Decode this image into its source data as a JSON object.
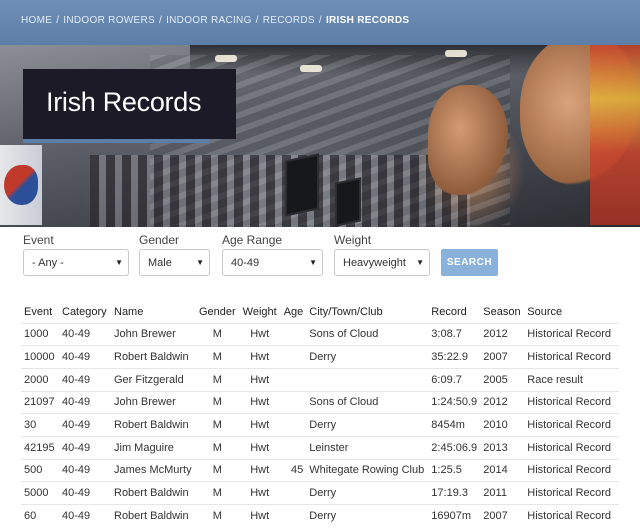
{
  "breadcrumb": {
    "items": [
      "Home",
      "Indoor Rowers",
      "Indoor Racing",
      "Records"
    ],
    "separator": "/",
    "current": "Irish Records"
  },
  "page": {
    "title": "Irish Records"
  },
  "filters": {
    "event": {
      "label": "Event",
      "value": "- Any -"
    },
    "gender": {
      "label": "Gender",
      "value": "Male"
    },
    "age_range": {
      "label": "Age Range",
      "value": "40-49"
    },
    "weight": {
      "label": "Weight",
      "value": "Heavyweight"
    },
    "search_label": "SEARCH"
  },
  "table": {
    "headers": [
      "Event",
      "Category",
      "Name",
      "Gender",
      "Weight",
      "Age",
      "City/Town/Club",
      "Record",
      "Season",
      "Source"
    ],
    "rows": [
      [
        "1000",
        "40-49",
        "John Brewer",
        "M",
        "Hwt",
        "",
        "Sons of Cloud",
        "3:08.7",
        "2012",
        "Historical Record"
      ],
      [
        "10000",
        "40-49",
        "Robert Baldwin",
        "M",
        "Hwt",
        "",
        "Derry",
        "35:22.9",
        "2007",
        "Historical Record"
      ],
      [
        "2000",
        "40-49",
        "Ger Fitzgerald",
        "M",
        "Hwt",
        "",
        "",
        "6:09.7",
        "2005",
        "Race result"
      ],
      [
        "21097",
        "40-49",
        "John Brewer",
        "M",
        "Hwt",
        "",
        "Sons of Cloud",
        "1:24:50.9",
        "2012",
        "Historical Record"
      ],
      [
        "30",
        "40-49",
        "Robert Baldwin",
        "M",
        "Hwt",
        "",
        "Derry",
        "8454m",
        "2010",
        "Historical Record"
      ],
      [
        "42195",
        "40-49",
        "Jim Maguire",
        "M",
        "Hwt",
        "",
        "Leinster",
        "2:45:06.9",
        "2013",
        "Historical Record"
      ],
      [
        "500",
        "40-49",
        "James McMurty",
        "M",
        "Hwt",
        "45",
        "Whitegate Rowing Club",
        "1:25.5",
        "2014",
        "Historical Record"
      ],
      [
        "5000",
        "40-49",
        "Robert Baldwin",
        "M",
        "Hwt",
        "",
        "Derry",
        "17:19.3",
        "2011",
        "Historical Record"
      ],
      [
        "60",
        "40-49",
        "Robert Baldwin",
        "M",
        "Hwt",
        "",
        "Derry",
        "16907m",
        "2007",
        "Historical Record"
      ]
    ]
  },
  "colors": {
    "breadcrumb_bar": "#5c7ea8",
    "title_box": "#1b1a26",
    "search_button": "#8ab1d9"
  },
  "icons": {
    "select_caret": "caret-down-icon"
  }
}
